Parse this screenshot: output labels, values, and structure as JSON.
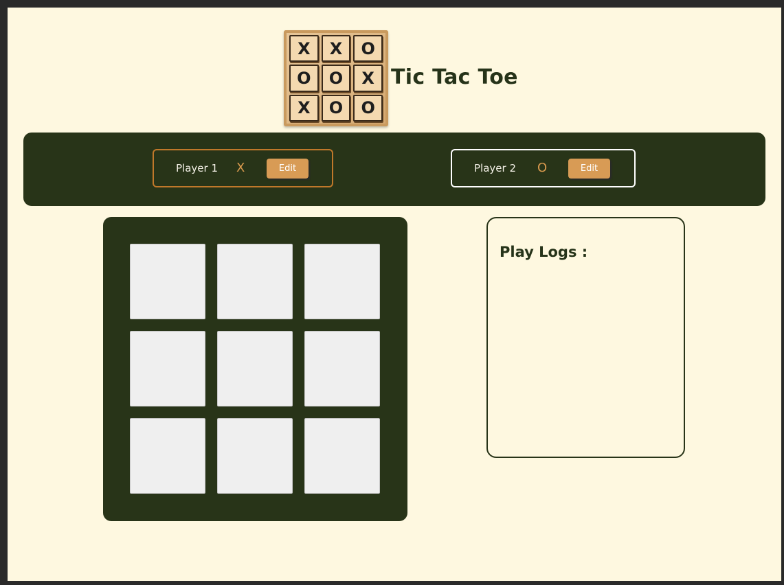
{
  "header": {
    "title": "Tic Tac Toe",
    "logo_board": [
      "X",
      "X",
      "O",
      "O",
      "O",
      "X",
      "X",
      "O",
      "O"
    ]
  },
  "players": [
    {
      "name": "Player 1",
      "symbol": "X",
      "edit_label": "Edit",
      "accent": "#c0782a"
    },
    {
      "name": "Player 2",
      "symbol": "O",
      "edit_label": "Edit",
      "accent": "#ffffff"
    }
  ],
  "board": {
    "cells": [
      "",
      "",
      "",
      "",
      "",
      "",
      "",
      "",
      ""
    ]
  },
  "logs": {
    "title": "Play Logs :"
  },
  "colors": {
    "background": "#fef8e0",
    "primary": "#283418",
    "button": "#d89b55",
    "cell": "#efefef"
  }
}
